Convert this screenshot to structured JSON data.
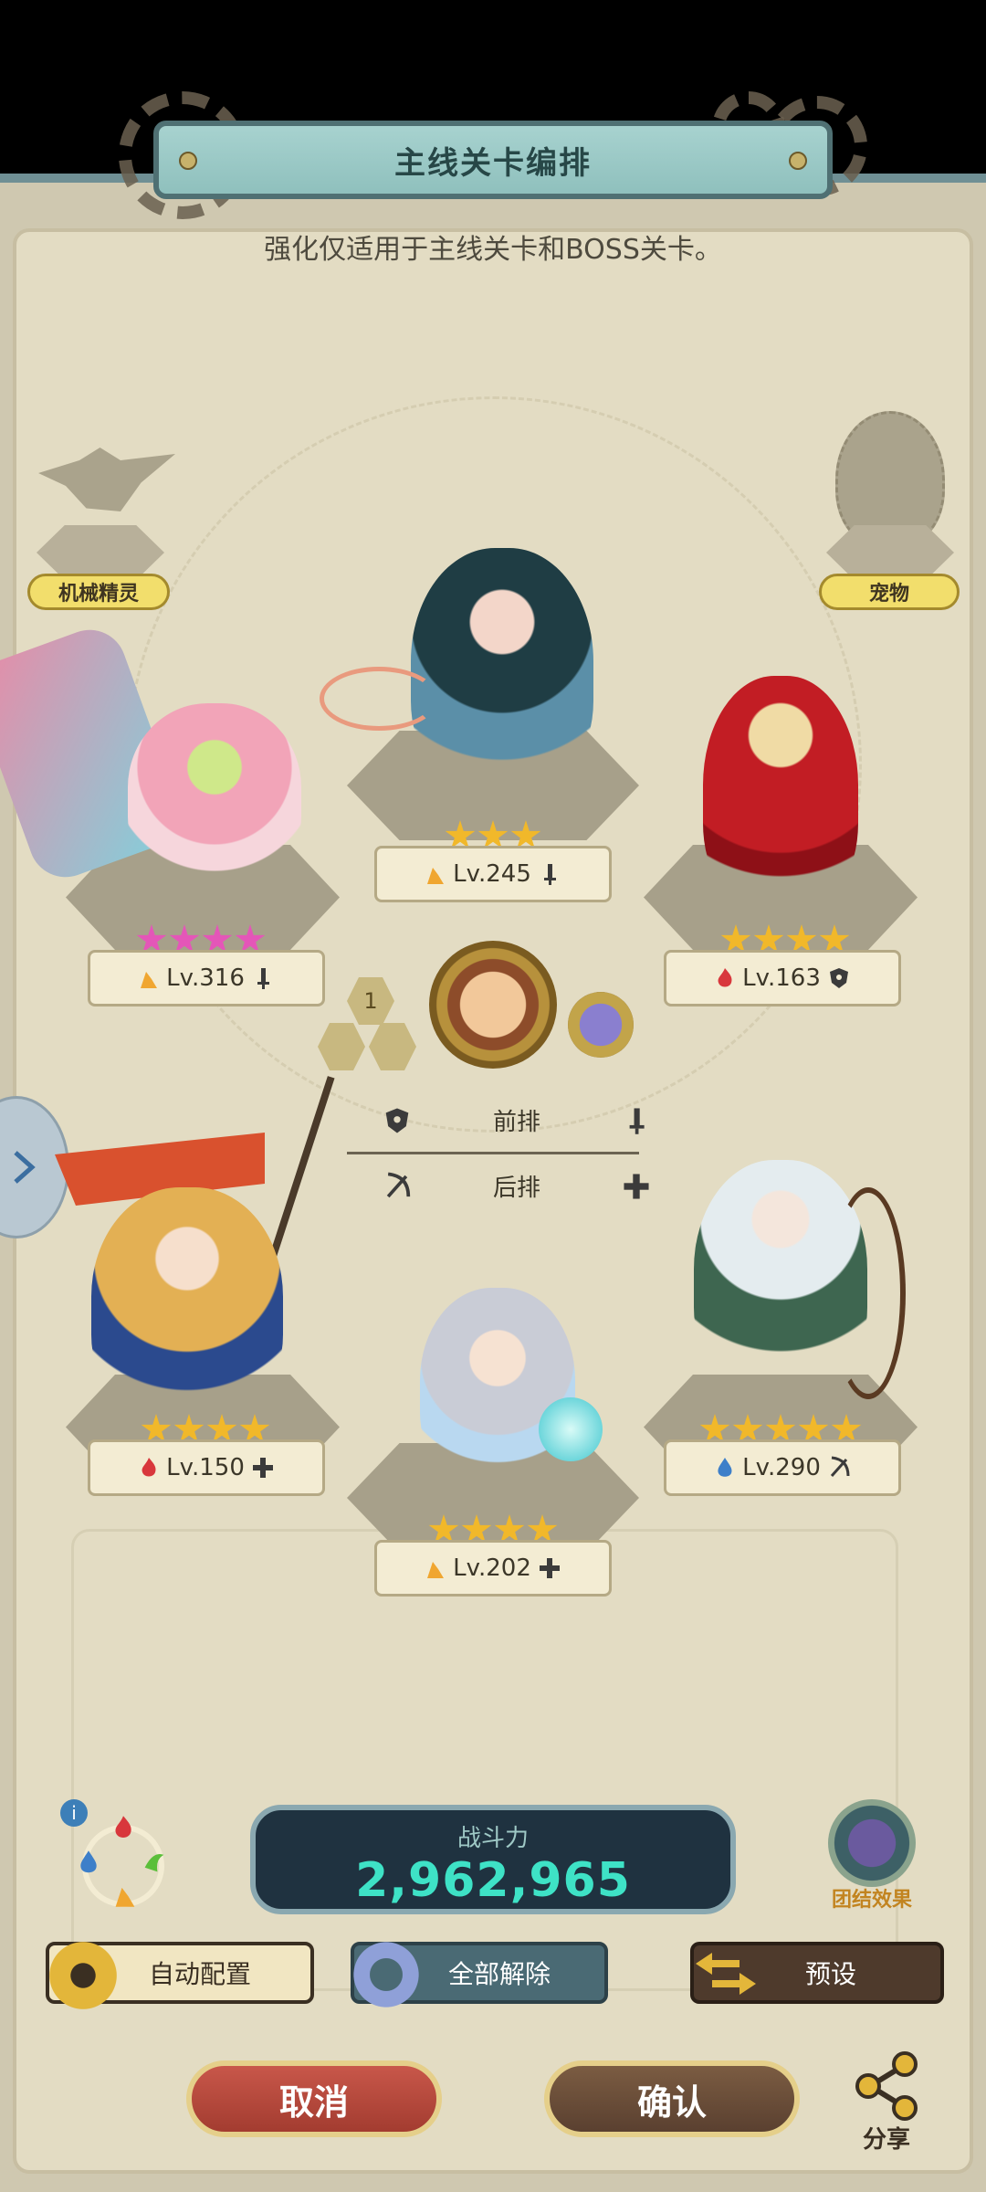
{
  "header": {
    "title": "主线关卡编排"
  },
  "subtitle": "强化仅适用于主线关卡和BOSS关卡。",
  "side_slots": {
    "left_label": "机械精灵",
    "right_label": "宠物"
  },
  "heroes": [
    {
      "slot": "top-center",
      "level": "Lv.245",
      "stars": 3,
      "star_color": "gold",
      "element": "earth-icon",
      "role": "sword-icon"
    },
    {
      "slot": "top-left",
      "level": "Lv.316",
      "stars": 4,
      "star_color": "pink",
      "element": "earth-icon",
      "role": "sword-icon"
    },
    {
      "slot": "top-right",
      "level": "Lv.163",
      "stars": 4,
      "star_color": "gold",
      "element": "fire-icon",
      "role": "shield-icon"
    },
    {
      "slot": "bottom-left",
      "level": "Lv.150",
      "stars": 4,
      "star_color": "gold",
      "element": "fire-icon",
      "role": "plus-icon"
    },
    {
      "slot": "bottom-center",
      "level": "Lv.202",
      "stars": 4,
      "star_color": "gold",
      "element": "earth-icon",
      "role": "plus-icon"
    },
    {
      "slot": "bottom-right",
      "level": "Lv.290",
      "stars": 5,
      "star_color": "gold",
      "element": "water-icon",
      "role": "bow-icon"
    }
  ],
  "leader": {
    "badge": "1"
  },
  "formation": {
    "front_label": "前排",
    "back_label": "后排"
  },
  "power": {
    "label": "战斗力",
    "value": "2,962,965"
  },
  "team_effect": {
    "label": "团结效果"
  },
  "buttons": {
    "auto": "自动配置",
    "clear": "全部解除",
    "preset": "预设",
    "cancel": "取消",
    "confirm": "确认",
    "share": "分享"
  },
  "colors": {
    "power_text": "#3ee2c6",
    "star": "#f1b82a",
    "star_pink": "#e456b8",
    "cancel": "#b8483a",
    "confirm": "#6b4e36"
  }
}
